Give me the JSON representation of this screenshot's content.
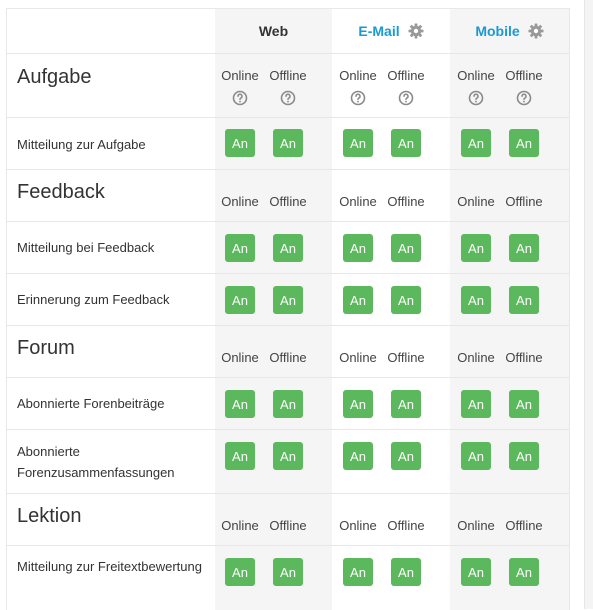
{
  "header": {
    "web": "Web",
    "email": "E-Mail",
    "mobile": "Mobile"
  },
  "states": {
    "online": "Online",
    "offline": "Offline"
  },
  "toggle_label": "An",
  "sections": [
    {
      "title": "Aufgabe",
      "items": [
        "Mitteilung zur Aufgabe"
      ]
    },
    {
      "title": "Feedback",
      "items": [
        "Mitteilung bei Feedback",
        "Erinnerung zum Feedback"
      ]
    },
    {
      "title": "Forum",
      "items": [
        "Abonnierte Forenbeiträge",
        "Abonnierte Forenzusammenfassungen"
      ]
    },
    {
      "title": "Lektion",
      "items": [
        "Mitteilung zur Freitextbewertung"
      ]
    }
  ],
  "colors": {
    "accent": "#1b9ad2",
    "on": "#5cb85c",
    "columnBg": "#f5f5f5"
  },
  "icons": {
    "settings": "gear-icon",
    "help": "help-icon"
  }
}
